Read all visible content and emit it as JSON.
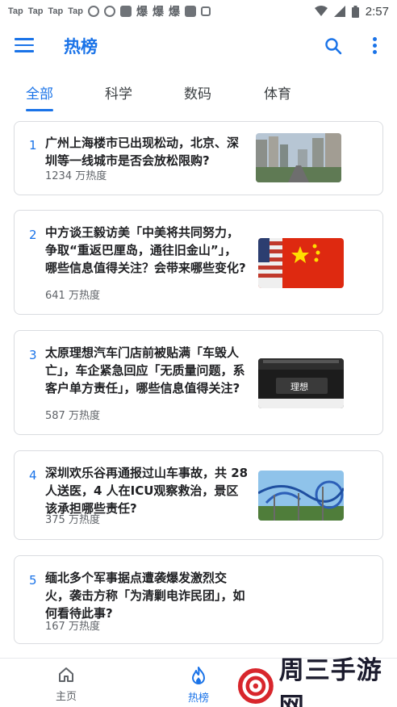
{
  "status_bar": {
    "left_items": [
      "Tap",
      "Tap",
      "Tap",
      "Tap"
    ],
    "weibo_icons": [
      "爆",
      "爆",
      "爆"
    ],
    "time": "2:57"
  },
  "app_bar": {
    "title": "热榜"
  },
  "tabs": [
    {
      "label": "全部",
      "active": true
    },
    {
      "label": "科学",
      "active": false
    },
    {
      "label": "数码",
      "active": false
    },
    {
      "label": "体育",
      "active": false
    }
  ],
  "items": [
    {
      "rank": "1",
      "title": "广州上海楼市已出现松动，北京、深圳等一线城市是否会放松限购?",
      "heat": "1234 万热度",
      "thumb": "city-skyline"
    },
    {
      "rank": "2",
      "title": "中方谈王毅访美「中美将共同努力，争取“重返巴厘岛，通往旧金山”」，哪些信息值得关注？会带来哪些变化?",
      "heat": "641 万热度",
      "thumb": "flags"
    },
    {
      "rank": "3",
      "title": "太原理想汽车门店前被贴满「车毁人亡」，车企紧急回应「无质量问题，系客户单方责任」，哪些信息值得关注?",
      "heat": "587 万热度",
      "thumb": "car-store",
      "thumb_brand": "理想"
    },
    {
      "rank": "4",
      "title": "深圳欢乐谷再通报过山车事故，共 28 人送医，4 人在ICU观察救治，景区该承担哪些责任?",
      "heat": "375 万热度",
      "thumb": "roller-coaster"
    },
    {
      "rank": "5",
      "title": "缅北多个军事据点遭袭爆发激烈交火，袭击方称「为清剿电诈民团」，如何看待此事?",
      "heat": "167 万热度",
      "thumb": null
    }
  ],
  "bottom_nav": [
    {
      "label": "主页",
      "icon": "home-icon",
      "active": false
    },
    {
      "label": "热榜",
      "icon": "flame-icon",
      "active": true
    }
  ],
  "watermark": {
    "text": "周三手游网"
  },
  "colors": {
    "accent": "#1a73e8",
    "text": "#202124",
    "muted": "#5f6368",
    "border": "#dadce0"
  }
}
